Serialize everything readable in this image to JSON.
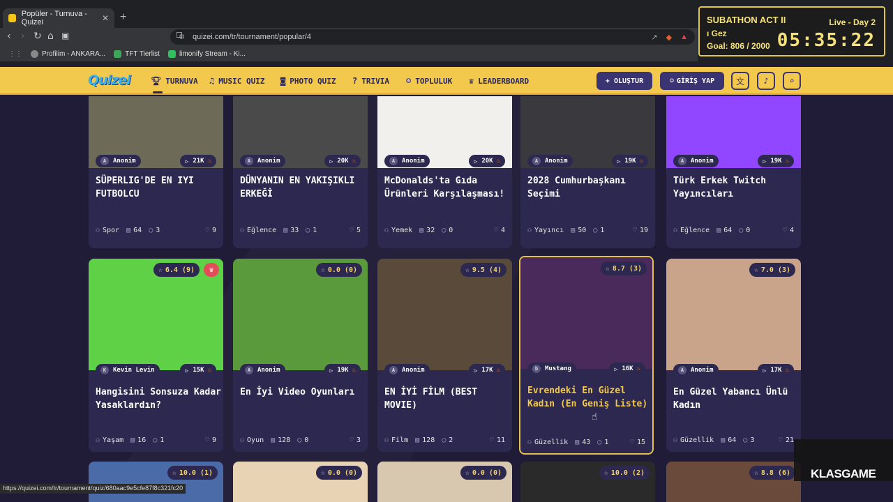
{
  "browser": {
    "tab_title": "Popüler - Turnuva - Quizei",
    "url": "quizei.com/tr/tournament/popular/4",
    "bookmarks": [
      "Profilim - ANKARA...",
      "TFT Tierlist",
      "limonify Stream - Ki..."
    ],
    "status_url": "https://quizei.com/tr/tournament/quiz/680aac9e5cfe87f8c321fc20"
  },
  "stream_overlay": {
    "title": "SUBATHON ACT II",
    "live": "Live - Day 2",
    "name": "ı Gez",
    "goal": "Goal: 806 / 2000",
    "timer": "05:35:22"
  },
  "navbar": {
    "logo": "Quizei",
    "items": [
      {
        "label": "TURNUVA",
        "icon": "trophy-icon"
      },
      {
        "label": "MUSIC QUIZ",
        "icon": "music-icon"
      },
      {
        "label": "PHOTO QUIZ",
        "icon": "camera-icon"
      },
      {
        "label": "TRIVIA",
        "icon": "question-icon"
      },
      {
        "label": "TOPLULUK",
        "icon": "users-icon"
      },
      {
        "label": "LEADERBOARD",
        "icon": "award-icon"
      }
    ],
    "create_label": "+ OLUŞTUR",
    "login_label": "GİRİŞ YAP"
  },
  "cards_row1": [
    {
      "author": "Anonim",
      "avatar": "A",
      "plays": "21K",
      "title": "SÜPERLIG'DE EN IYI FUTBOLCU",
      "category": "Spor",
      "items": "64",
      "comments": "3",
      "likes": "9",
      "color": "#6e6a58"
    },
    {
      "author": "Anonim",
      "avatar": "A",
      "plays": "20K",
      "title": "DÜNYANIN EN YAKIŞIKLI ERKEĞİ",
      "category": "Eğlence",
      "items": "33",
      "comments": "1",
      "likes": "5",
      "color": "#4a4a4a"
    },
    {
      "author": "Anonim",
      "avatar": "A",
      "plays": "20K",
      "title": "McDonalds'ta Gıda Ürünleri Karşılaşması!",
      "category": "Yemek",
      "items": "32",
      "comments": "0",
      "likes": "4",
      "color": "#f2f0ec"
    },
    {
      "author": "Anonim",
      "avatar": "A",
      "plays": "19K",
      "title": "2028 Cumhurbaşkanı Seçimi",
      "category": "Yayıncı",
      "items": "50",
      "comments": "1",
      "likes": "19",
      "color": "#3a3a3e"
    },
    {
      "author": "Anonim",
      "avatar": "A",
      "plays": "19K",
      "title": "Türk Erkek Twitch Yayıncıları",
      "category": "Eğlence",
      "items": "64",
      "comments": "0",
      "likes": "4",
      "color": "#9146ff"
    }
  ],
  "cards_row2": [
    {
      "rating": "6.4 (9)",
      "crown": true,
      "author": "Kevin Levin",
      "avatar": "K",
      "plays": "15K",
      "title": "Hangisini Sonsuza Kadar Yasaklardın?",
      "category": "Yaşam",
      "items": "16",
      "comments": "1",
      "likes": "9",
      "color": "#5fd146"
    },
    {
      "rating": "0.0 (0)",
      "crown": false,
      "author": "Anonim",
      "avatar": "A",
      "plays": "19K",
      "title": "En İyi Video Oyunları",
      "category": "Oyun",
      "items": "128",
      "comments": "0",
      "likes": "3",
      "color": "#5a9a3c"
    },
    {
      "rating": "9.5 (4)",
      "crown": false,
      "author": "Anonim",
      "avatar": "A",
      "plays": "17K",
      "title": "EN İYİ FİLM (BEST MOVIE)",
      "category": "Film",
      "items": "128",
      "comments": "2",
      "likes": "11",
      "color": "#5a4a3a"
    },
    {
      "rating": "8.7 (3)",
      "crown": false,
      "author": "Mustang",
      "avatar": "b",
      "plays": "16K",
      "title": "Evrendeki En Güzel Kadın (En Geniş Liste)",
      "category": "Güzellik",
      "items": "43",
      "comments": "1",
      "likes": "15",
      "color": "#4a2a5a"
    },
    {
      "rating": "7.0 (3)",
      "crown": false,
      "author": "Anonim",
      "avatar": "A",
      "plays": "17K",
      "title": "En Güzel Yabancı Ünlü Kadın",
      "category": "Güzellik",
      "items": "64",
      "comments": "3",
      "likes": "21",
      "color": "#c9a38a"
    }
  ],
  "cards_row3": [
    {
      "rating": "10.0 (1)",
      "color": "#4a6aa8"
    },
    {
      "rating": "0.0 (0)",
      "color": "#e8d4b4"
    },
    {
      "rating": "0.0 (0)",
      "color": "#d8c8b0"
    },
    {
      "rating": "10.0 (2)",
      "color": "#2a2a2a"
    },
    {
      "rating": "8.8 (6)",
      "color": "#6a4a3a"
    }
  ],
  "watermark": "KLASGAME"
}
